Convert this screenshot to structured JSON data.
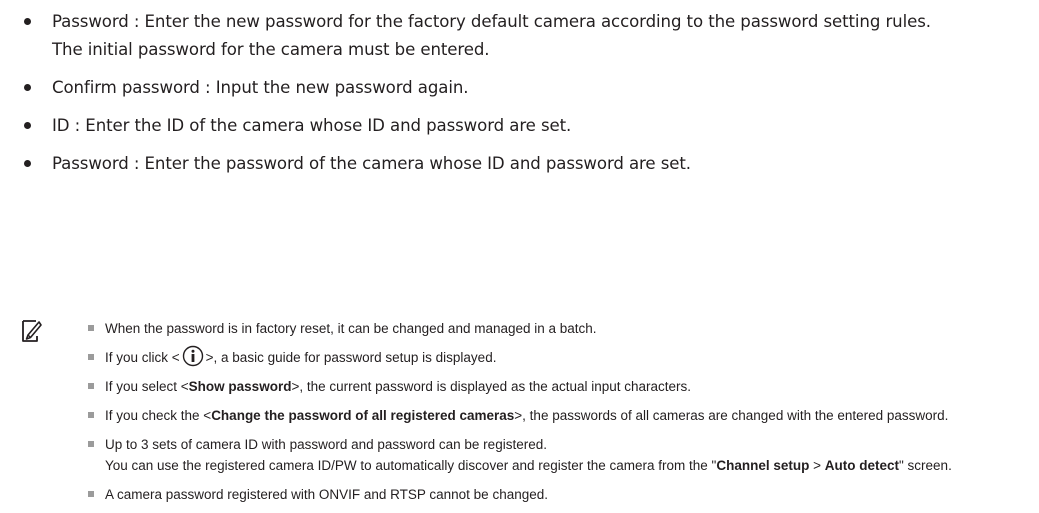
{
  "bullets": [
    {
      "line1": "Password : Enter the new password for the factory default camera according to the password setting rules.",
      "line2": "The initial password for the camera must be entered."
    },
    {
      "line1": "Confirm password : Input the new password again."
    },
    {
      "line1": "ID : Enter the ID of the camera whose ID and password are set."
    },
    {
      "line1": "Password : Enter the password of the camera whose ID and password are set."
    }
  ],
  "notes": {
    "n1": "When the password is in factory reset, it can be changed and managed in a batch.",
    "n2_pre": "If you click <",
    "n2_post": ">, a basic guide for password setup is displayed.",
    "n2_icon": "info-icon",
    "n3_pre": "If you select <",
    "n3_bold": "Show password",
    "n3_post": ">, the current password is displayed as the actual input characters.",
    "n4_pre": "If you check the <",
    "n4_bold": "Change the password of all registered cameras",
    "n4_post": ">, the passwords of all cameras are changed with the entered password.",
    "n5_l1": "Up to 3 sets of camera ID with password and password can be registered.",
    "n5_pre": "You can use the registered camera ID/PW to automatically discover and register the camera from the \"",
    "n5_b1": "Channel setup",
    "n5_mid": " > ",
    "n5_b2": "Auto detect",
    "n5_post": "\" screen.",
    "n6": "A camera password registered with ONVIF and RTSP cannot be changed."
  },
  "note_icon": "pencil-note-icon"
}
